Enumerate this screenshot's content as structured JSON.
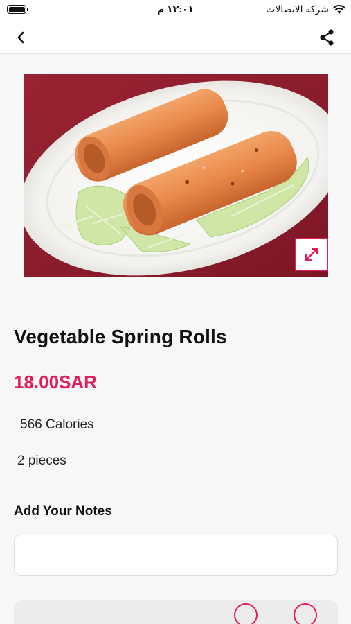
{
  "status_bar": {
    "time": "١٢:٠١ م",
    "carrier": "شركة الاتصالات",
    "icons": [
      "battery-icon",
      "wifi-icon"
    ]
  },
  "nav": {
    "back_icon": "chevron-left-icon",
    "share_icon": "share-icon"
  },
  "item": {
    "image_alt": "Vegetable Spring Rolls",
    "expand_icon": "expand-icon",
    "title": "Vegetable Spring Rolls",
    "price": "18.00SAR",
    "calories": "566 Calories",
    "pieces": "2 pieces"
  },
  "notes": {
    "label": "Add Your Notes",
    "value": "",
    "placeholder": ""
  },
  "colors": {
    "accent": "#e61c58",
    "background": "#f7f7f7"
  }
}
